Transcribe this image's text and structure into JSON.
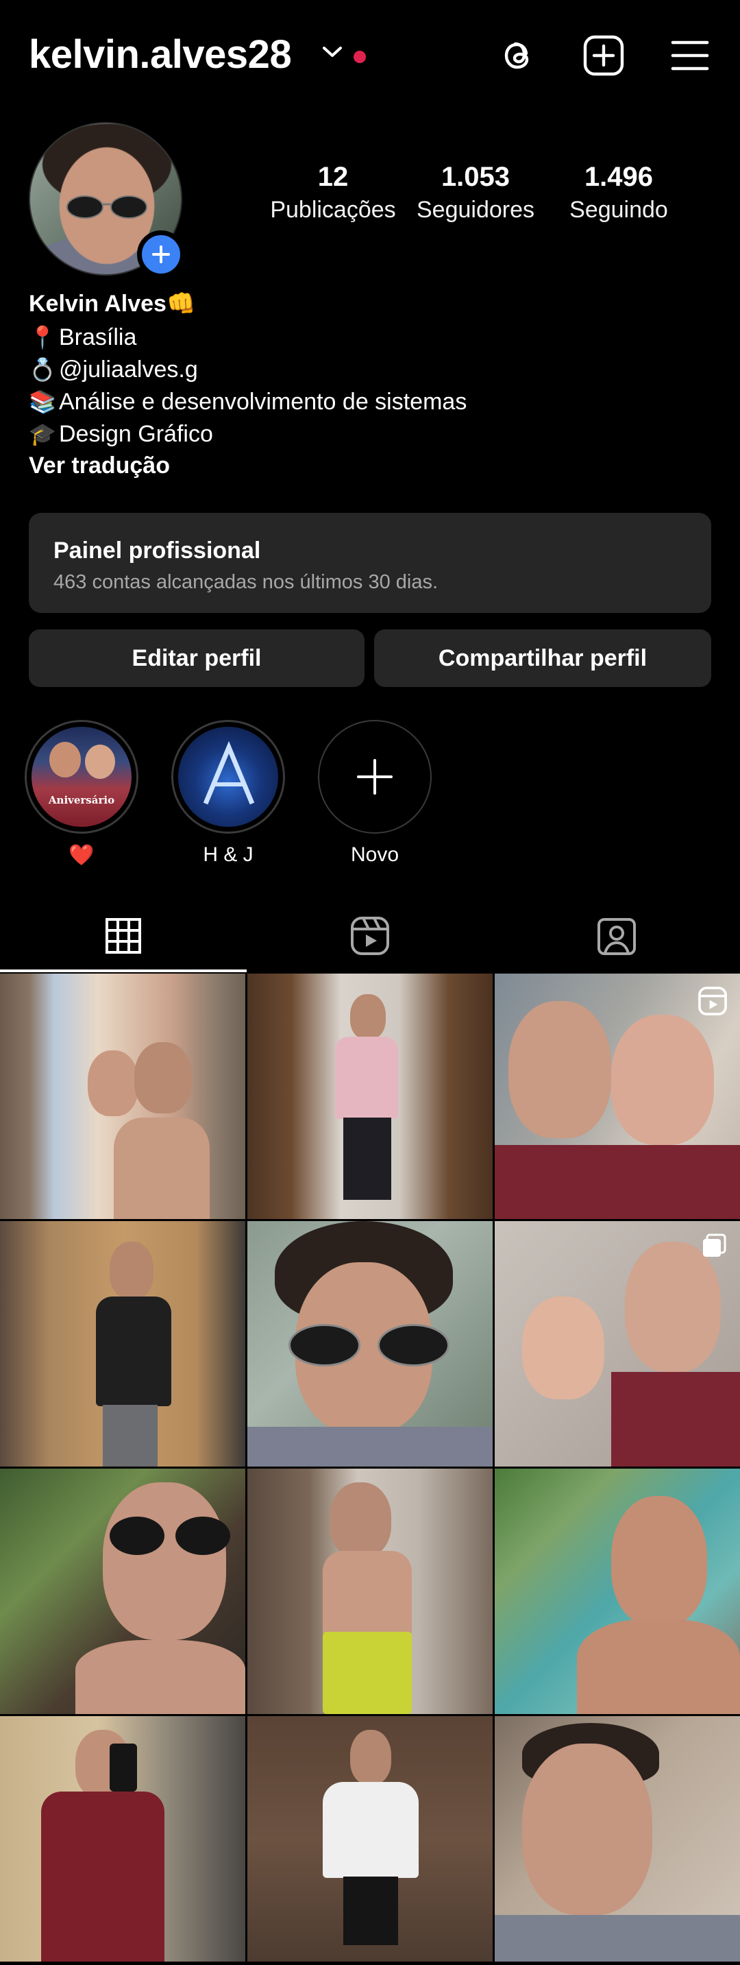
{
  "header": {
    "username": "kelvin.alves28",
    "notification_color": "#e0234e",
    "icons": [
      "threads-icon",
      "create-icon",
      "menu-icon"
    ]
  },
  "profile": {
    "stats": [
      {
        "value": "12",
        "label": "Publicações"
      },
      {
        "value": "1.053",
        "label": "Seguidores"
      },
      {
        "value": "1.496",
        "label": "Seguindo"
      }
    ],
    "name": "Kelvin Alves👊",
    "bio_lines": [
      {
        "emoji": "📍",
        "text": "Brasília"
      },
      {
        "emoji": "💍",
        "text": "@juliaalves.g"
      },
      {
        "emoji": "📚",
        "text": "Análise e desenvolvimento de sistemas"
      },
      {
        "emoji": "🎓",
        "text": "Design Gráfico"
      }
    ],
    "translate_label": "Ver tradução"
  },
  "panel": {
    "title": "Painel profissional",
    "subtitle": "463 contas alcançadas nos últimos 30 dias."
  },
  "buttons": {
    "edit": "Editar perfil",
    "share": "Compartilhar perfil"
  },
  "highlights": [
    {
      "label": "❤️",
      "cover_text": "Aniversário"
    },
    {
      "label": "H & J"
    },
    {
      "label": "Novo"
    }
  ],
  "tabs": [
    "grid-icon",
    "reels-icon",
    "tagged-icon"
  ],
  "colors": {
    "background": "#000000",
    "surface": "#262626",
    "accent_blue": "#3b82f6",
    "secondary_text": "#a8a8a8"
  }
}
